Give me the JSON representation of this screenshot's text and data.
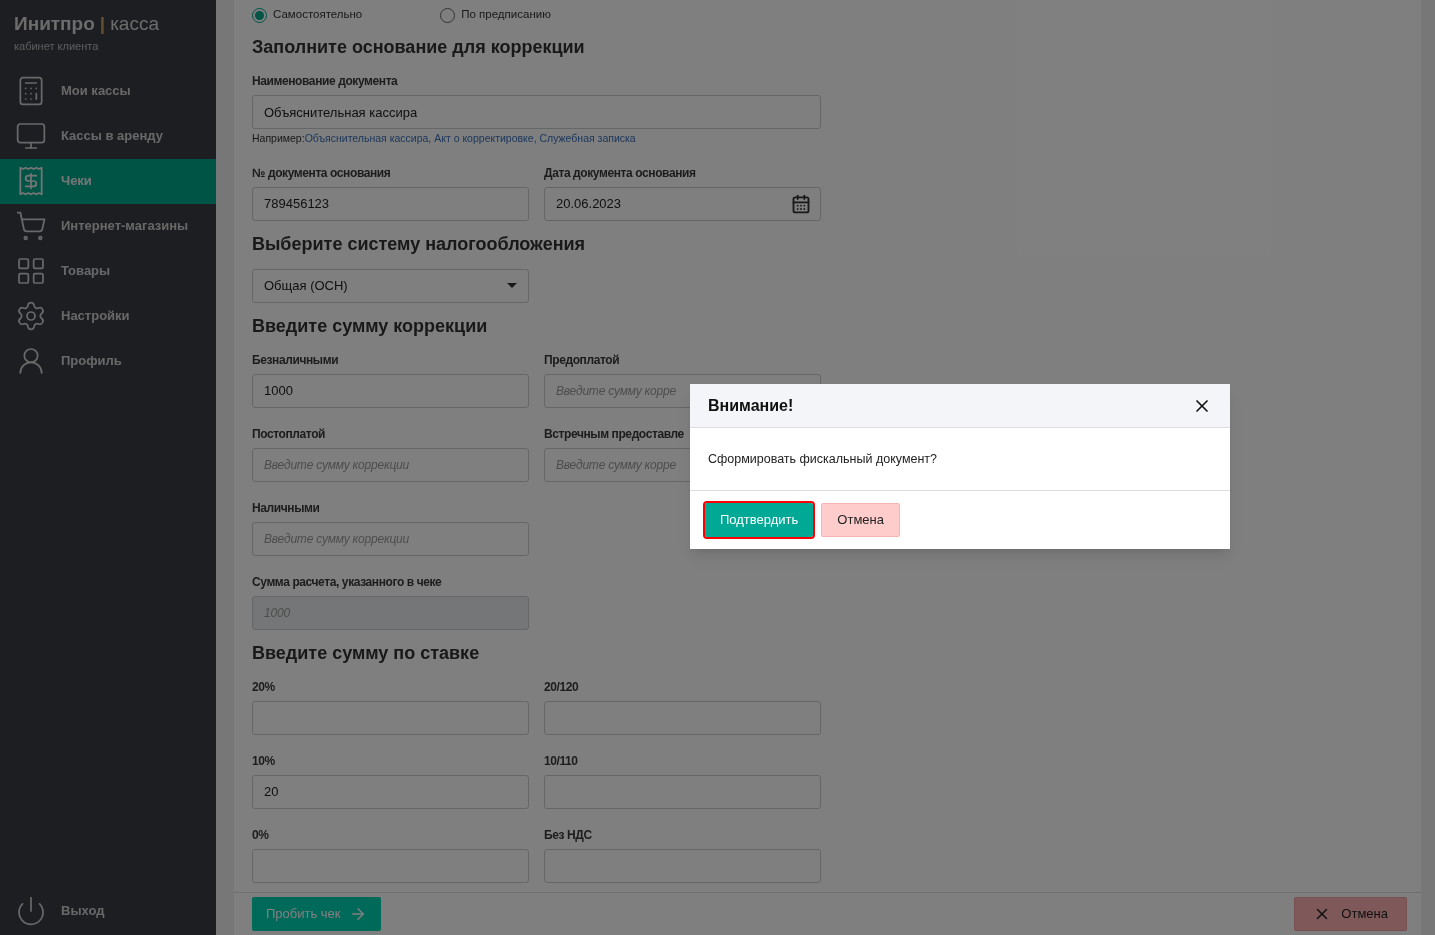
{
  "sidebar": {
    "logo_bold": "Инитпро",
    "logo_separator": "|",
    "logo_light": "касса",
    "subtitle": "кабинет клиента",
    "items": [
      {
        "label": "Мои кассы",
        "selected": false
      },
      {
        "label": "Кассы в аренду",
        "selected": false
      },
      {
        "label": "Чеки",
        "selected": true
      },
      {
        "label": "Интернет-магазины",
        "selected": false
      },
      {
        "label": "Товары",
        "selected": false
      },
      {
        "label": "Настройки",
        "selected": false
      },
      {
        "label": "Профиль",
        "selected": false
      }
    ],
    "logout": "Выход"
  },
  "form": {
    "mode_options": [
      {
        "label": "Самостоятельно",
        "selected": true
      },
      {
        "label": "По предписанию",
        "selected": false
      }
    ],
    "sections": [
      {
        "title": "Заполните основание для коррекции",
        "fields": [
          {
            "kind": "wide",
            "label": "Наименование документа",
            "value": "Объяснительная кассира",
            "hint_prefix": "Например:",
            "hint_link": "Объяснительная кассира, Акт о корректировке, Служебная записка"
          },
          {
            "kind": "text",
            "label": "№ документа основания",
            "value": "789456123"
          },
          {
            "kind": "date",
            "label": "Дата документа основания",
            "value": "20.06.2023"
          }
        ]
      },
      {
        "title": "Выберите систему налогообложения",
        "fields": [
          {
            "kind": "select",
            "value": "Общая (ОСН)"
          }
        ]
      },
      {
        "title": "Введите сумму коррекции",
        "fields": [
          {
            "kind": "text",
            "label": "Безналичными",
            "value": "1000"
          },
          {
            "kind": "text",
            "label": "Предоплатой",
            "placeholder": "Введите сумму корре"
          },
          {
            "kind": "text",
            "label": "Постоплатой",
            "placeholder": "Введите сумму коррекции"
          },
          {
            "kind": "text",
            "label": "Встречным предоставле",
            "placeholder": "Введите сумму корре"
          },
          {
            "kind": "text",
            "label": "Наличными",
            "placeholder": "Введите сумму коррекции"
          },
          {
            "kind": "blank"
          },
          {
            "kind": "disabled",
            "label": "Сумма расчета, указанного в чеке",
            "placeholder": "1000"
          }
        ]
      },
      {
        "title": "Введите сумму по ставке",
        "fields": [
          {
            "kind": "text",
            "label": "20%"
          },
          {
            "kind": "text",
            "label": "20/120"
          },
          {
            "kind": "text",
            "label": "10%",
            "value": "20"
          },
          {
            "kind": "text",
            "label": "10/110"
          },
          {
            "kind": "text",
            "label": "0%"
          },
          {
            "kind": "text",
            "label": "Без НДС"
          }
        ]
      }
    ]
  },
  "footer": {
    "submit": "Пробить чек",
    "cancel": "Отмена"
  },
  "modal": {
    "title": "Внимание!",
    "message": "Сформировать фискальный документ?",
    "buttons": [
      {
        "label": "Подтвердить",
        "kind": "confirm",
        "focused": true
      },
      {
        "label": "Отмена",
        "kind": "cancel",
        "focused": false
      }
    ]
  }
}
